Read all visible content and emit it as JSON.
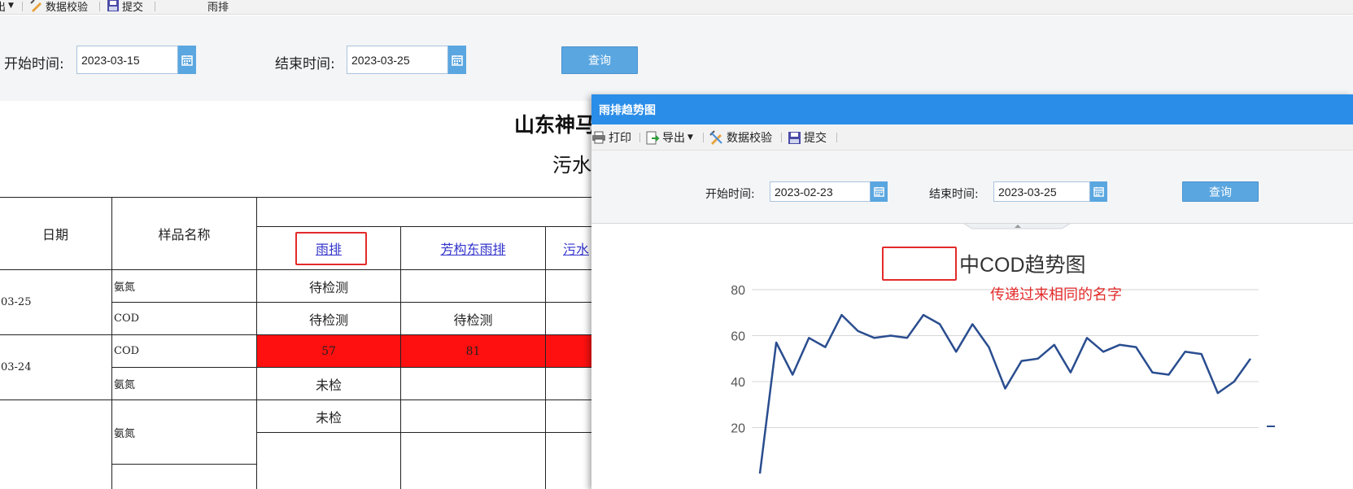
{
  "bg_toolbar": {
    "export_label": "出",
    "validate_label": "数据校验",
    "submit_label": "提交",
    "current_item": "雨排"
  },
  "bg_filter": {
    "start_label": "开始时间:",
    "start_value": "2023-03-15",
    "end_label": "结束时间:",
    "end_value": "2023-03-25",
    "query_label": "查询"
  },
  "report": {
    "title": "山东神马",
    "subtitle": "污水",
    "headers": {
      "date": "日期",
      "sample": "样品名称",
      "col1": "雨排",
      "col2": "芳构东雨排",
      "col3": "污水"
    },
    "rows": [
      {
        "date": "03-25",
        "sample": "氨氮",
        "v1": "待检测",
        "v2": ""
      },
      {
        "date": "",
        "sample": "COD",
        "v1": "待检测",
        "v2": "待检测"
      },
      {
        "date": "03-24",
        "sample": "COD",
        "v1": "57",
        "v2": "81"
      },
      {
        "date": "",
        "sample": "氨氮",
        "v1": "未检",
        "v2": ""
      },
      {
        "date": "",
        "sample": "氨氮",
        "v1": "未检",
        "v2": ""
      }
    ]
  },
  "dialog": {
    "title": "雨排趋势图",
    "toolbar": {
      "print_label": "打印",
      "export_label": "导出",
      "validate_label": "数据校验",
      "submit_label": "提交"
    },
    "filter": {
      "start_label": "开始时间:",
      "start_value": "2023-02-23",
      "end_label": "结束时间:",
      "end_value": "2023-03-25",
      "query_label": "查询"
    }
  },
  "annotation": {
    "text": "传递过来相同的名字",
    "color": "#e32b2b"
  },
  "chart_data": {
    "type": "line",
    "title": "中COD趋势图",
    "ylim": [
      0,
      80
    ],
    "yticks": [
      20,
      40,
      60,
      80
    ],
    "grid": true,
    "series": [
      {
        "color": "#2a4d8f",
        "values": [
          0,
          57,
          43,
          59,
          55,
          69,
          62,
          59,
          60,
          59,
          69,
          65,
          53,
          65,
          55,
          37,
          49,
          50,
          56,
          44,
          59,
          53,
          56,
          55,
          44,
          43,
          53,
          52,
          35,
          40,
          50
        ]
      }
    ]
  }
}
